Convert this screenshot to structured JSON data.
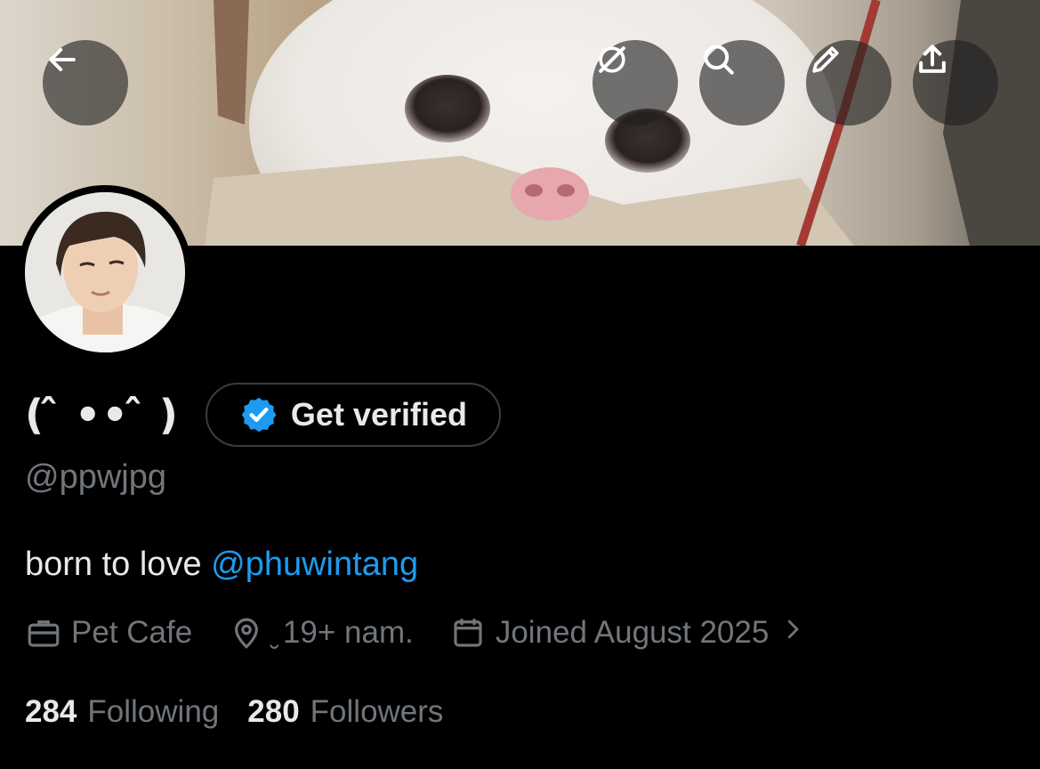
{
  "profile": {
    "display_name": "( ̂ •• ̂ )",
    "verify_label": "Get verified",
    "handle": "@ppwjpg",
    "bio_text": "born to love ",
    "bio_mention": "@phuwintang",
    "work": "Pet Cafe",
    "location": "̮ 19+ nam.",
    "joined": "Joined August 2025",
    "following_count": "284",
    "following_label": "Following",
    "followers_count": "280",
    "followers_label": "Followers"
  },
  "icons": {
    "back": "arrow-left-icon",
    "grok": "grok-icon",
    "search": "search-icon",
    "edit": "pencil-icon",
    "share": "share-icon",
    "verified": "verified-badge-icon",
    "work": "briefcase-icon",
    "location": "location-pin-icon",
    "calendar": "calendar-icon",
    "chevron": "chevron-right-icon"
  },
  "colors": {
    "background": "#000000",
    "accent": "#1d9bf0",
    "muted": "#71767b",
    "text": "#e7e9ea"
  }
}
